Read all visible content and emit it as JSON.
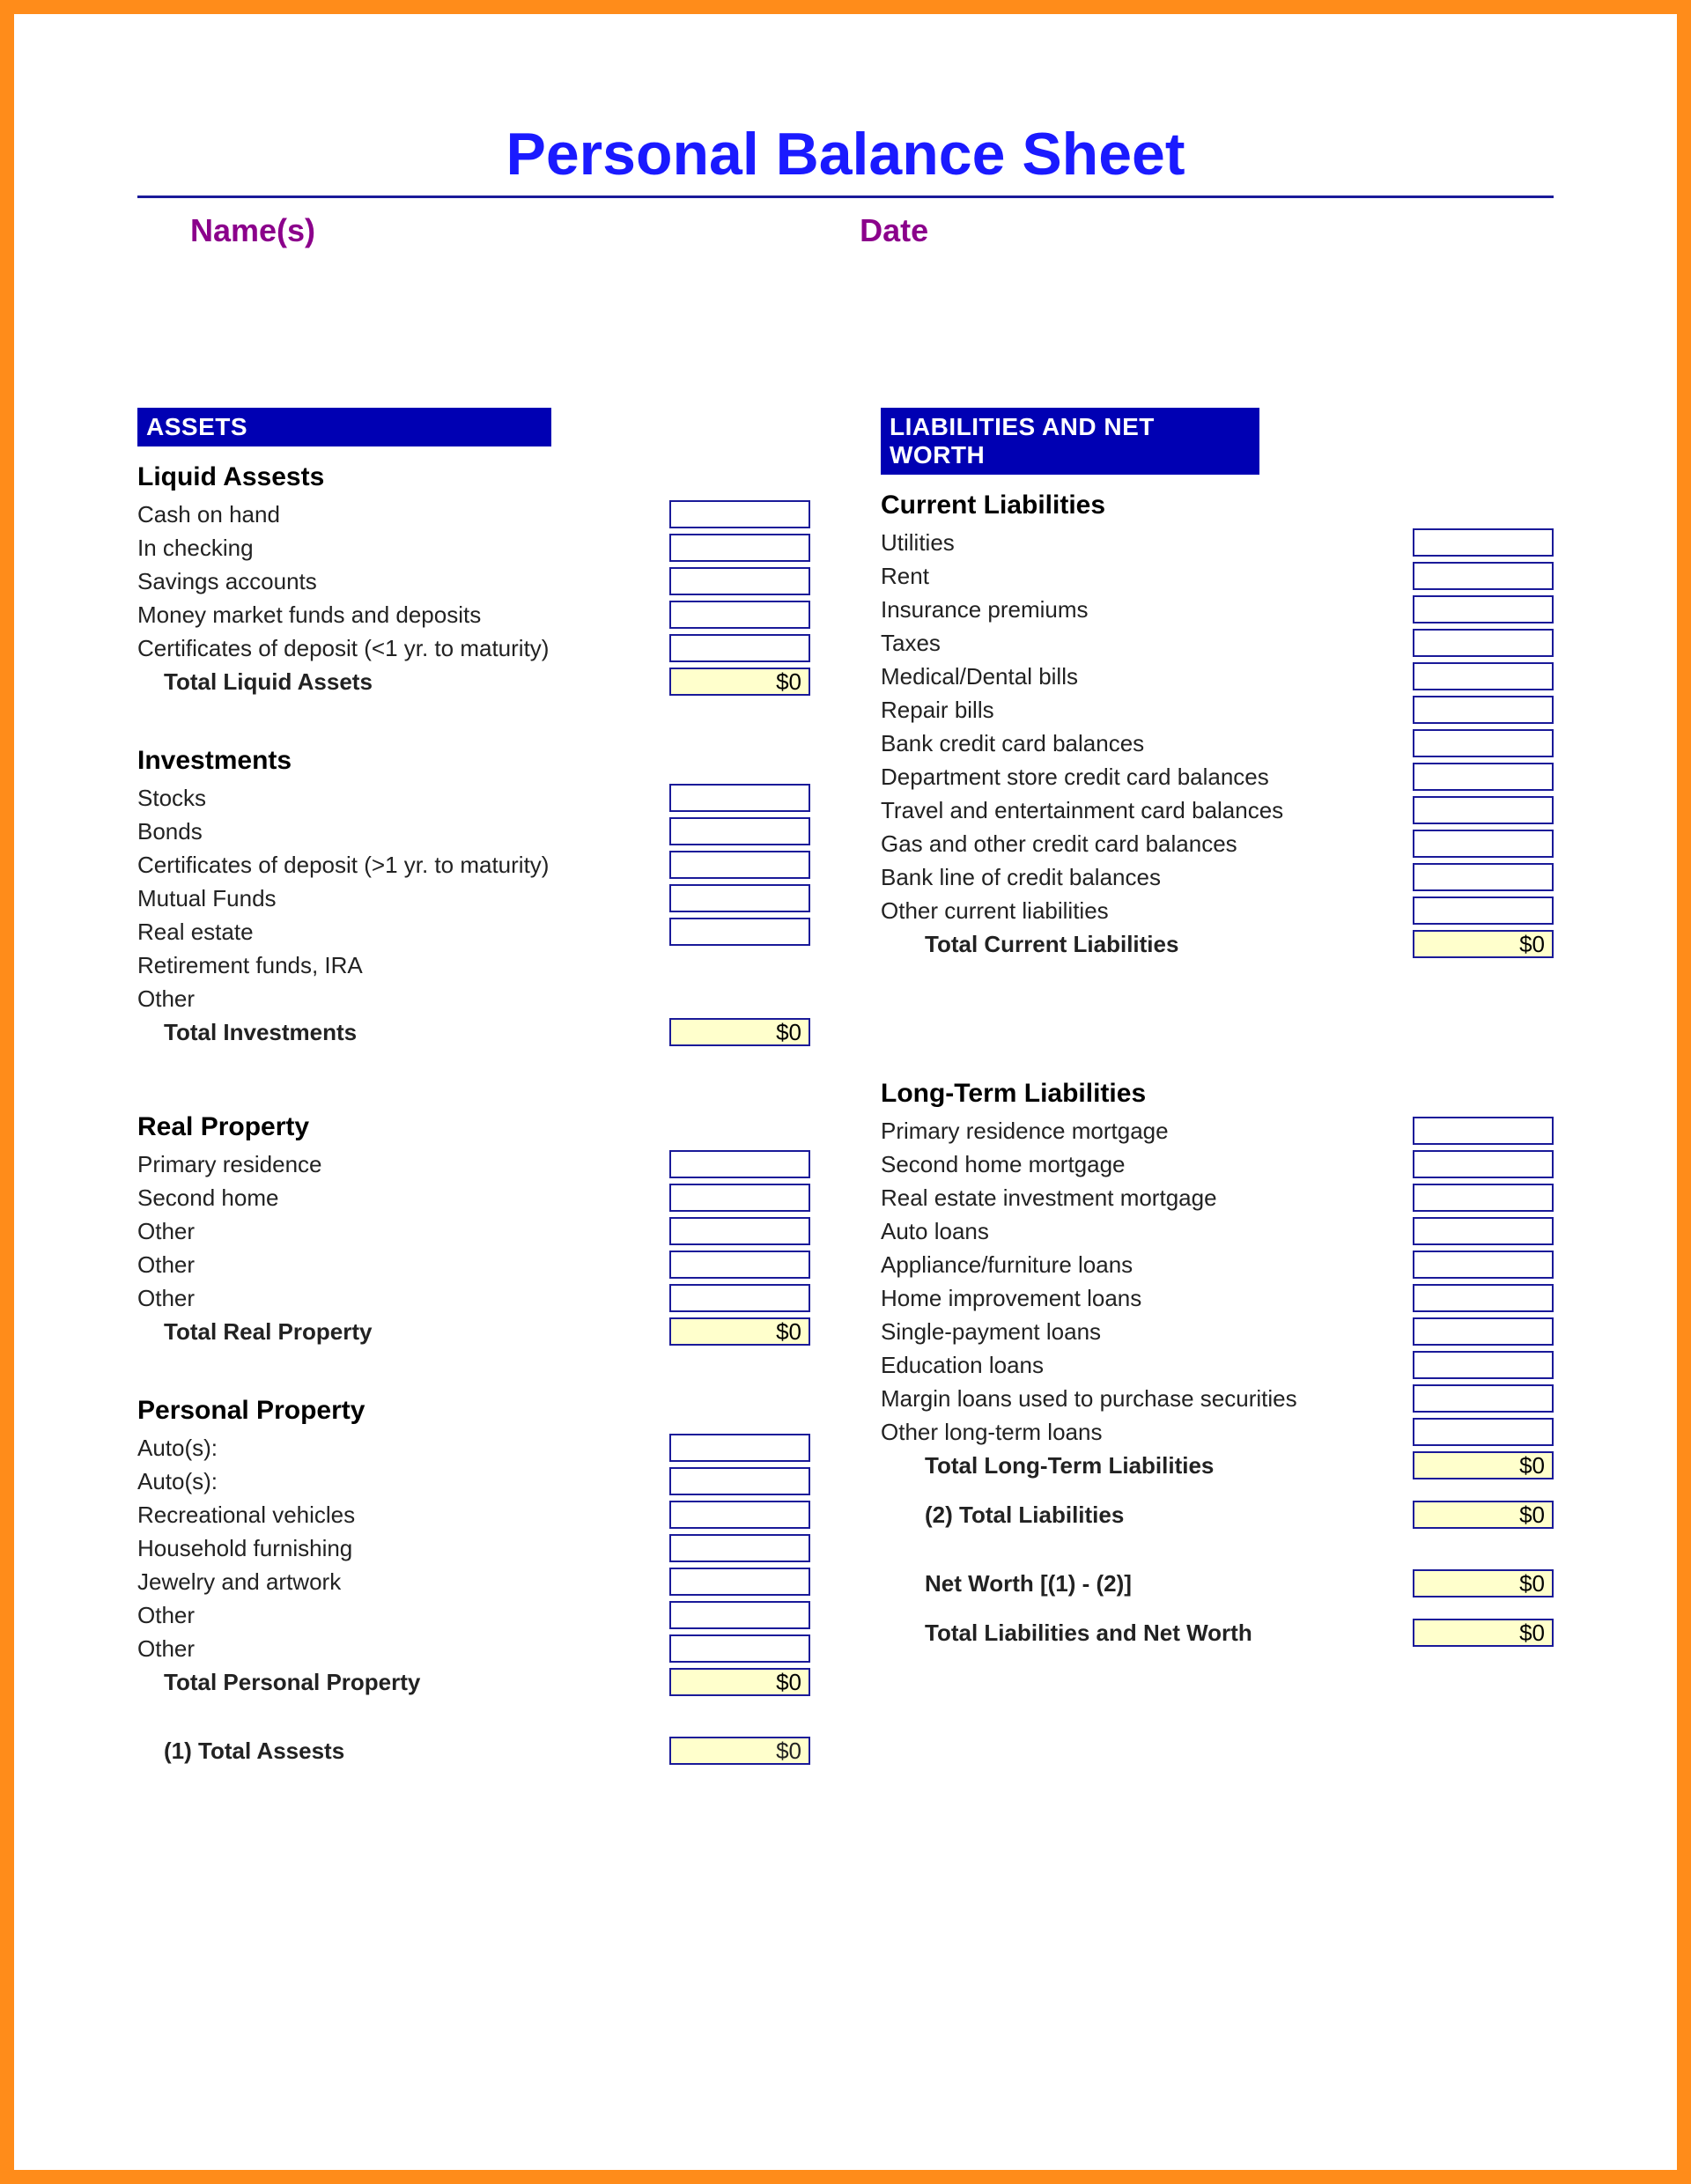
{
  "title": "Personal Balance Sheet",
  "header": {
    "name_label": "Name(s)",
    "date_label": "Date"
  },
  "left": {
    "band": "ASSETS",
    "liquid": {
      "head": "Liquid Assests",
      "items": [
        "Cash on hand",
        "In checking",
        "Savings accounts",
        "Money market funds and deposits",
        "Certificates of deposit (<1 yr. to maturity)"
      ],
      "total_label": "Total Liquid Assets",
      "total_value": "$0"
    },
    "investments": {
      "head": "Investments",
      "items": [
        "Stocks",
        "Bonds",
        "Certificates of deposit (>1 yr. to maturity)",
        "Mutual Funds",
        "Real estate",
        "Retirement funds, IRA",
        "Other"
      ],
      "cell_flags": [
        true,
        true,
        true,
        true,
        true,
        false,
        false
      ],
      "total_label": "Total Investments",
      "total_value": "$0"
    },
    "real_property": {
      "head": "Real Property",
      "items": [
        "Primary residence",
        "Second home",
        "Other",
        "Other",
        "Other"
      ],
      "total_label": "Total Real Property",
      "total_value": "$0"
    },
    "personal_property": {
      "head": "Personal Property",
      "items": [
        "Auto(s):",
        "Auto(s):",
        "Recreational vehicles",
        "Household furnishing",
        "Jewelry and artwork",
        "Other",
        "Other"
      ],
      "total_label": "Total Personal Property",
      "total_value": "$0"
    },
    "grand": {
      "label": "(1) Total Assests",
      "value": "$0"
    }
  },
  "right": {
    "band": "LIABILITIES AND NET WORTH",
    "current": {
      "head": "Current Liabilities",
      "items": [
        "Utilities",
        "Rent",
        "Insurance premiums",
        "Taxes",
        "Medical/Dental bills",
        "Repair bills",
        "Bank credit card balances",
        "Department store credit card balances",
        "Travel and entertainment card balances",
        "Gas and other credit card balances",
        "Bank line of credit balances",
        "Other current liabilities"
      ],
      "total_label": "Total Current Liabilities",
      "total_value": "$0"
    },
    "longterm": {
      "head": "Long-Term Liabilities",
      "items": [
        "Primary residence mortgage",
        "Second home mortgage",
        "Real estate investment mortgage",
        "Auto loans",
        "Appliance/furniture loans",
        "Home improvement loans",
        "Single-payment loans",
        "Education loans",
        "Margin loans used to purchase securities",
        "Other long-term loans"
      ],
      "total_label": "Total Long-Term Liabilities",
      "total_value": "$0"
    },
    "total_liab": {
      "label": "(2) Total Liabilities",
      "value": "$0"
    },
    "networth": {
      "label": "Net Worth [(1) - (2)]",
      "value": "$0"
    },
    "total_all": {
      "label": "Total Liabilities and Net Worth",
      "value": "$0"
    }
  }
}
